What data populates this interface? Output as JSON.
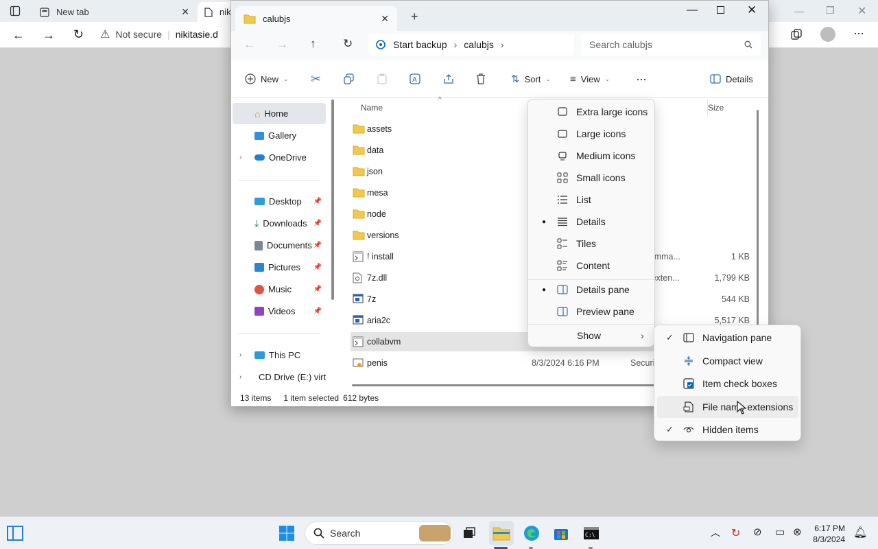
{
  "browser": {
    "tab1_label": "New tab",
    "tab2_label": "nik",
    "not_secure": "Not secure",
    "url": "nikitasie.d"
  },
  "explorer": {
    "tab_title": "calubjs",
    "breadcrumb": [
      "Start backup",
      "calubjs"
    ],
    "search_placeholder": "Search calubjs",
    "toolbar": {
      "new": "New",
      "sort": "Sort",
      "view": "View",
      "details": "Details"
    },
    "nav": {
      "home": "Home",
      "gallery": "Gallery",
      "onedrive": "OneDrive",
      "desktop": "Desktop",
      "downloads": "Downloads",
      "documents": "Documents",
      "pictures": "Pictures",
      "music": "Music",
      "videos": "Videos",
      "thispc": "This PC",
      "cddrive": "CD Drive (E:) virt"
    },
    "columns": {
      "name": "Name",
      "size": "Size"
    },
    "files": [
      {
        "name": "assets",
        "date": "",
        "type": "der",
        "size": "",
        "icon": "folder"
      },
      {
        "name": "data",
        "date": "",
        "type": "der",
        "size": "",
        "icon": "folder"
      },
      {
        "name": "json",
        "date": "",
        "type": "der",
        "size": "",
        "icon": "folder"
      },
      {
        "name": "mesa",
        "date": "",
        "type": "der",
        "size": "",
        "icon": "folder"
      },
      {
        "name": "node",
        "date": "",
        "type": "der",
        "size": "",
        "icon": "folder"
      },
      {
        "name": "versions",
        "date": "",
        "type": "der",
        "size": "",
        "icon": "folder"
      },
      {
        "name": "! install",
        "date": "",
        "type": "ws Comma...",
        "size": "1 KB",
        "icon": "script"
      },
      {
        "name": "7z.dll",
        "date": "",
        "type": "ation exten...",
        "size": "1,799 KB",
        "icon": "dll"
      },
      {
        "name": "7z",
        "date": "",
        "type": "ation",
        "size": "544 KB",
        "icon": "exe"
      },
      {
        "name": "aria2c",
        "date": "",
        "type": "ation",
        "size": "5,517 KB",
        "icon": "exe"
      },
      {
        "name": "collabvm",
        "date": "",
        "type": "",
        "size": "",
        "icon": "script"
      },
      {
        "name": "penis",
        "date": "8/3/2024 6:16 PM",
        "type": "Securit",
        "size": "",
        "icon": "cert"
      }
    ],
    "status": {
      "items": "13 items",
      "selected": "1 item selected",
      "bytes": "612 bytes"
    }
  },
  "view_menu": {
    "items": [
      {
        "label": "Extra large icons",
        "icon": "extra-large-icons-icon",
        "bullet": false
      },
      {
        "label": "Large icons",
        "icon": "large-icons-icon",
        "bullet": false
      },
      {
        "label": "Medium icons",
        "icon": "medium-icons-icon",
        "bullet": false
      },
      {
        "label": "Small icons",
        "icon": "small-icons-icon",
        "bullet": false
      },
      {
        "label": "List",
        "icon": "list-icon",
        "bullet": false
      },
      {
        "label": "Details",
        "icon": "details-icon",
        "bullet": true
      },
      {
        "label": "Tiles",
        "icon": "tiles-icon",
        "bullet": false
      },
      {
        "label": "Content",
        "icon": "content-icon",
        "bullet": false
      }
    ],
    "pane_items": [
      {
        "label": "Details pane",
        "bullet": true
      },
      {
        "label": "Preview pane",
        "bullet": false
      }
    ],
    "show": "Show"
  },
  "show_menu": {
    "items": [
      {
        "label": "Navigation pane",
        "checked": true
      },
      {
        "label": "Compact view",
        "checked": false
      },
      {
        "label": "Item check boxes",
        "checked": false
      },
      {
        "label": "File name extensions",
        "checked": false
      },
      {
        "label": "Hidden items",
        "checked": true
      }
    ]
  },
  "taskbar": {
    "search": "Search",
    "time": "6:17 PM",
    "date": "8/3/2024"
  },
  "colors": {
    "accent": "#0067c0",
    "folder": "#f2c94c"
  }
}
